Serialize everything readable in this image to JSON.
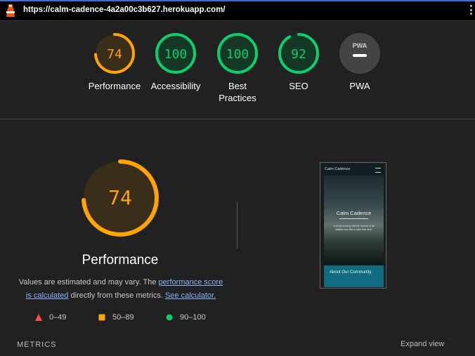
{
  "url": "https://calm-cadence-4a2a00c3b627.herokuapp.com/",
  "colors": {
    "pass": "#0cce6b",
    "average": "#ffa400",
    "fail": "#ff4e42",
    "link": "#8ab4f8",
    "pwa": "#444444"
  },
  "categories": [
    {
      "label": "Performance",
      "score": "74",
      "fraction": 0.74,
      "status": "average"
    },
    {
      "label": "Accessibility",
      "score": "100",
      "fraction": 1.0,
      "status": "pass"
    },
    {
      "label": "Best Practices",
      "score": "100",
      "fraction": 1.0,
      "status": "pass"
    },
    {
      "label": "SEO",
      "score": "92",
      "fraction": 0.92,
      "status": "pass"
    },
    {
      "label": "PWA",
      "badge": "PWA",
      "status": "na"
    }
  ],
  "performance": {
    "score": "74",
    "fraction": 0.74,
    "title": "Performance",
    "desc_prefix": "Values are estimated and may vary. The ",
    "desc_link1": "performance score is calculated",
    "desc_middle": " directly from these metrics. ",
    "desc_link2": "See calculator."
  },
  "legend": [
    {
      "shape": "triangle",
      "range": "0–49"
    },
    {
      "shape": "square",
      "range": "50–89"
    },
    {
      "shape": "circle",
      "range": "90–100"
    }
  ],
  "metrics_label": "METRICS",
  "expand_label": "Expand view",
  "screenshot": {
    "brand": "Calm Cadence",
    "hero_title": "Calm Cadence",
    "hero_sub": "A social running club for runners of all abilities who like to take their time.",
    "footer_text": "About Our Community"
  }
}
